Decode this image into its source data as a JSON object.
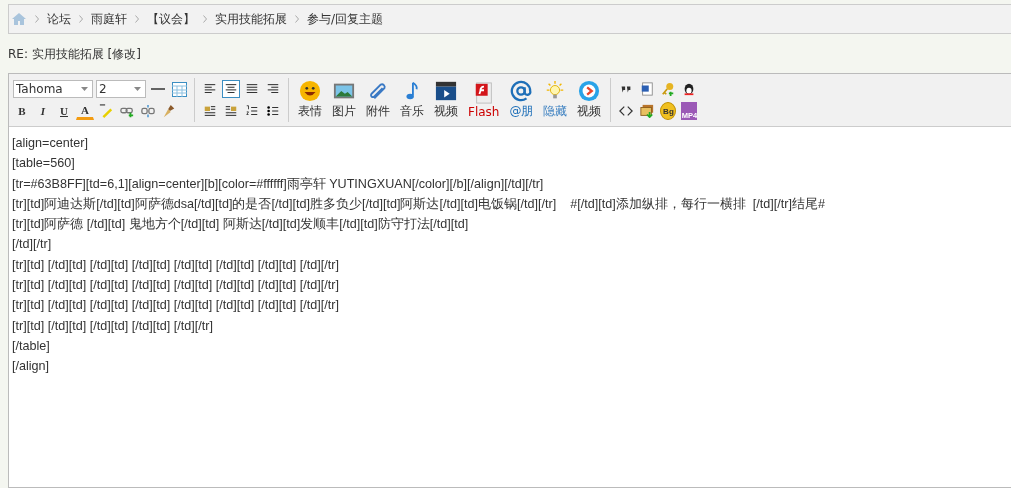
{
  "breadcrumb": [
    "论坛",
    "雨庭轩",
    "【议会】",
    "实用技能拓展",
    "参与/回复主题"
  ],
  "post_title": "RE: 实用技能拓展 [修改]",
  "toolbar": {
    "font": "Tahoma",
    "size": "2",
    "format_buttons": [
      {
        "kind": "bold",
        "label": "B"
      },
      {
        "kind": "italic",
        "label": "I"
      },
      {
        "kind": "underline",
        "label": "U"
      },
      {
        "kind": "color",
        "label": "A"
      },
      {
        "kind": "highlight"
      },
      {
        "kind": "link"
      },
      {
        "kind": "unlink"
      },
      {
        "kind": "eraser"
      }
    ],
    "align_buttons": [
      {
        "kind": "left",
        "selected": false
      },
      {
        "kind": "center",
        "selected": true
      },
      {
        "kind": "justify",
        "selected": false
      },
      {
        "kind": "right",
        "selected": false
      }
    ],
    "layout_buttons": [
      {
        "kind": "float-left"
      },
      {
        "kind": "float-right"
      },
      {
        "kind": "ordered"
      },
      {
        "kind": "unordered"
      }
    ],
    "insert_buttons": [
      {
        "kind": "smiley",
        "label": "表情"
      },
      {
        "kind": "image",
        "label": "图片"
      },
      {
        "kind": "attach",
        "label": "附件"
      },
      {
        "kind": "music",
        "label": "音乐"
      },
      {
        "kind": "video",
        "label": "视频"
      },
      {
        "kind": "flash",
        "label": "Flash"
      },
      {
        "kind": "at",
        "label": "@朋"
      },
      {
        "kind": "hide",
        "label": "隐藏"
      },
      {
        "kind": "play",
        "label": "视频"
      }
    ],
    "extra_buttons": [
      {
        "kind": "quote"
      },
      {
        "kind": "document"
      },
      {
        "kind": "key"
      },
      {
        "kind": "penguin"
      },
      {
        "kind": "code"
      },
      {
        "kind": "picture-down"
      },
      {
        "kind": "badge",
        "label": "Bg"
      },
      {
        "kind": "mp4",
        "label": "MP4"
      }
    ]
  },
  "editor_lines": [
    "[align=center]",
    "[table=560]",
    "[tr=#63B8FF][td=6,1][align=center][b][color=#ffffff]雨亭轩 YUTINGXUAN[/color][/b][/align][/td][/tr]",
    "[tr][td]阿迪达斯[/td][td]阿萨德dsa[/td][td]的是否[/td][td]胜多负少[/td][td]阿斯达[/td][td]电饭锅[/td][/tr]    #[/td][td]添加纵排，每行一横排  [/td][/tr]结尾#",
    "[tr][td]阿萨德 [/td][td] 鬼地方个[/td][td] 阿斯达[/td][td]发顺丰[/td][td]防守打法[/td][td]",
    "[/td][/tr]",
    "[tr][td] [/td][td] [/td][td] [/td][td] [/td][td] [/td][td] [/td][td] [/td][/tr]",
    "[tr][td] [/td][td] [/td][td] [/td][td] [/td][td] [/td][td] [/td][td] [/td][/tr]",
    "[tr][td] [/td][td] [/td][td] [/td][td] [/td][td] [/td][td] [/td][td] [/td][/tr]",
    "[tr][td] [/td][td] [/td][td] [/td][td] [/td][/tr]",
    "[/table]",
    "[/align]"
  ]
}
